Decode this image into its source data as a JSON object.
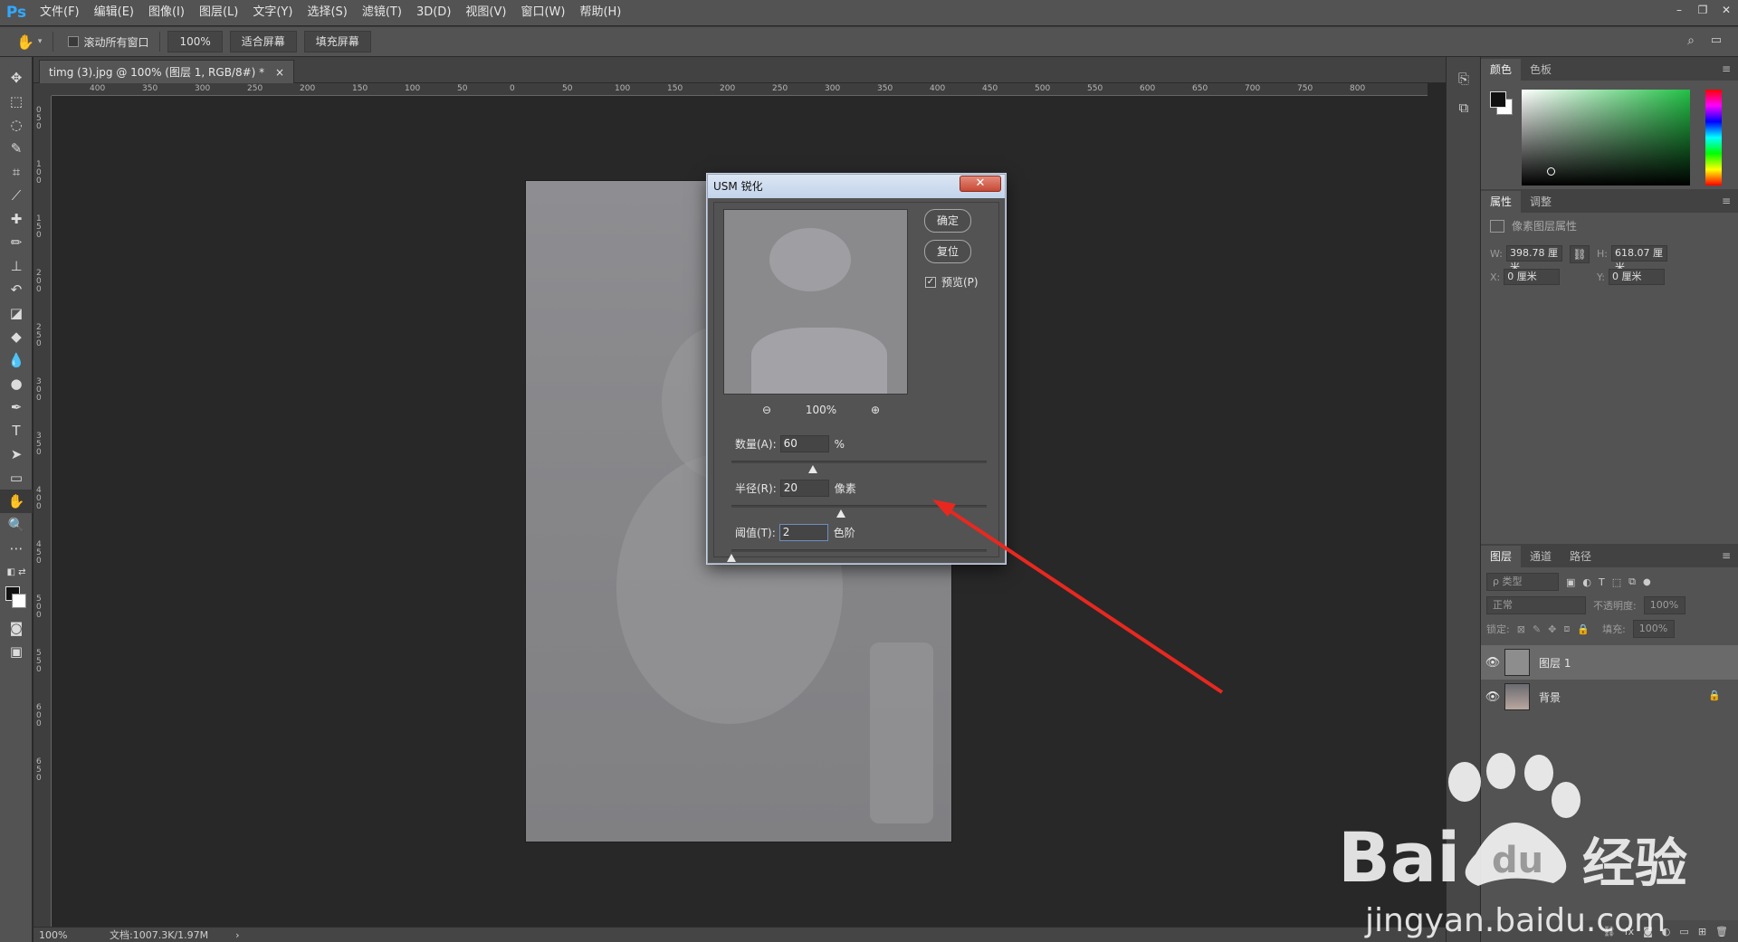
{
  "menubar": {
    "logo": "Ps",
    "items": [
      "文件(F)",
      "编辑(E)",
      "图像(I)",
      "图层(L)",
      "文字(Y)",
      "选择(S)",
      "滤镜(T)",
      "3D(D)",
      "视图(V)",
      "窗口(W)",
      "帮助(H)"
    ]
  },
  "options": {
    "scroll_all_label": "滚动所有窗口",
    "zoom_value": "100%",
    "fit_screen_label": "适合屏幕",
    "fill_screen_label": "填充屏幕"
  },
  "document": {
    "tab_title": "timg (3).jpg @ 100% (图层 1, RGB/8#) *",
    "tab_close": "×"
  },
  "ruler": {
    "top_labels": [
      "400",
      "350",
      "300",
      "250",
      "200",
      "150",
      "100",
      "50",
      "0",
      "50",
      "100",
      "150",
      "200",
      "250",
      "300",
      "350",
      "400",
      "450",
      "500",
      "550",
      "600",
      "650",
      "700",
      "750",
      "800"
    ],
    "left_labels": [
      "0",
      "5",
      "0",
      "1",
      "0",
      "0",
      "1",
      "5",
      "0",
      "2",
      "0",
      "0",
      "2",
      "5",
      "0",
      "3",
      "0",
      "0",
      "3",
      "5",
      "0",
      "4",
      "0",
      "0",
      "4",
      "5",
      "0",
      "5",
      "0",
      "0",
      "5",
      "5",
      "0",
      "6",
      "0",
      "0",
      "6",
      "5",
      "0"
    ]
  },
  "status": {
    "zoom": "100%",
    "doc_info": "文档:1007.3K/1.97M",
    "arrow": "›"
  },
  "color_panel": {
    "tabs": [
      "颜色",
      "色板"
    ]
  },
  "properties_panel": {
    "tabs": [
      "属性",
      "调整"
    ],
    "title": "像素图层属性",
    "w_label": "W:",
    "w_value": "398.78 厘米",
    "h_label": "H:",
    "h_value": "618.07 厘米",
    "x_label": "X:",
    "x_value": "0 厘米",
    "y_label": "Y:",
    "y_value": "0 厘米"
  },
  "layers_panel": {
    "tabs": [
      "图层",
      "通道",
      "路径"
    ],
    "filter_kind": "ρ 类型",
    "blend_mode": "正常",
    "opacity_label": "不透明度:",
    "opacity_value": "100%",
    "lock_label": "锁定:",
    "fill_label": "填充:",
    "fill_value": "100%",
    "layers": [
      {
        "name": "图层 1",
        "selected": true,
        "locked": false
      },
      {
        "name": "背景",
        "selected": false,
        "locked": true
      }
    ],
    "bottom_icons": [
      "link-icon",
      "fx-icon",
      "mask-icon",
      "adjustment-icon",
      "folder-icon",
      "new-layer-icon",
      "trash-icon"
    ],
    "fx_text": "fx"
  },
  "dialog": {
    "title": "USM 锐化",
    "close": "✕",
    "ok_label": "确定",
    "reset_label": "复位",
    "preview_label": "预览(P)",
    "preview_checked": true,
    "zoom_out": "⊖",
    "zoom_level": "100%",
    "zoom_in": "⊕",
    "amount": {
      "label": "数量(A):",
      "value": "60",
      "unit": "%",
      "slider_fraction": 0.32
    },
    "radius": {
      "label": "半径(R):",
      "value": "20",
      "unit": "像素",
      "slider_fraction": 0.43
    },
    "threshold": {
      "label": "阈值(T):",
      "value": "2",
      "unit": "色阶",
      "slider_fraction": 0.0
    }
  },
  "annotation": {
    "arrow_color": "#e8281f"
  },
  "watermark": {
    "brand": "Bai",
    "du": "du",
    "suffix": "经验",
    "url": "jingyan.baidu.com"
  },
  "colors": {
    "accent": "#31a8ff",
    "panel_bg": "#535353",
    "canvas_bg": "#282828"
  }
}
